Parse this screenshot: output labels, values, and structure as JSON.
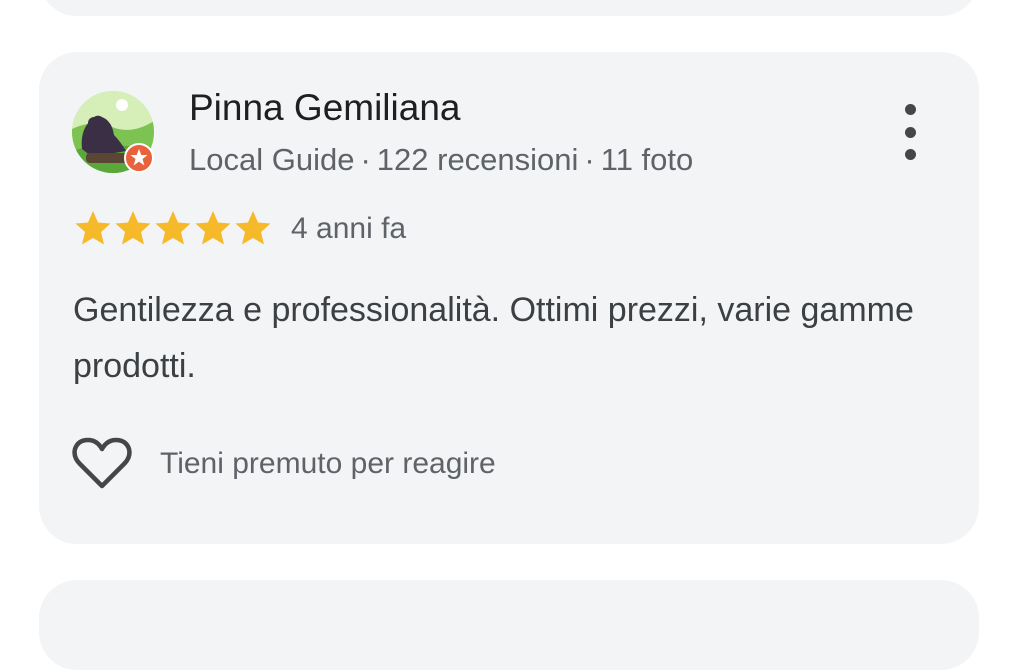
{
  "review": {
    "author_name": "Pinna Gemiliana",
    "author_role": "Local Guide",
    "review_count": "122 recensioni",
    "photo_count": "11 foto",
    "separator": "·",
    "rating": 5,
    "date": "4 anni fa",
    "text": "Gentilezza e professionalità. Ottimi prezzi, varie gamme prodotti.",
    "react_label": "Tieni premuto per reagire"
  },
  "colors": {
    "card_bg": "#f3f4f6",
    "star": "#f6b92a",
    "local_guide_badge": "#e8633c"
  },
  "icons": {
    "more": "more-vert-icon",
    "star": "star-icon",
    "react": "heart-outline-icon",
    "badge": "local-guide-badge-icon"
  }
}
